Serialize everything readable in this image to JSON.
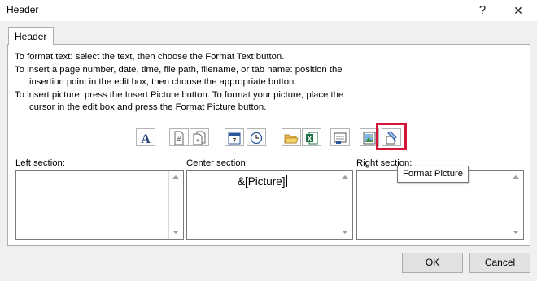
{
  "window": {
    "title": "Header",
    "help_label": "?",
    "close_label": "✕"
  },
  "tab": {
    "label": "Header"
  },
  "instructions": [
    "To format text:  select the text, then choose the Format Text button.",
    "To insert a page number, date, time, file path, filename, or tab name:  position the",
    "insertion point in the edit box, then choose the appropriate button.",
    "To insert picture: press the Insert Picture button.  To format your picture, place the",
    "cursor in the edit box and press the Format Picture button."
  ],
  "toolbar": [
    {
      "name": "format-text",
      "icon": "format-text-icon",
      "glyph": "A"
    },
    {
      "name": "insert-page-number",
      "icon": "page-number-icon"
    },
    {
      "name": "insert-number-of-pages",
      "icon": "number-of-pages-icon"
    },
    {
      "name": "insert-date",
      "icon": "calendar-icon",
      "glyph": "7"
    },
    {
      "name": "insert-time",
      "icon": "clock-icon"
    },
    {
      "name": "insert-file-path",
      "icon": "folder-icon"
    },
    {
      "name": "insert-file-name",
      "icon": "excel-icon",
      "glyph": "X"
    },
    {
      "name": "insert-sheet-name",
      "icon": "sheet-tab-icon"
    },
    {
      "name": "insert-picture",
      "icon": "picture-icon"
    },
    {
      "name": "format-picture",
      "icon": "format-picture-icon"
    }
  ],
  "highlight_color": "#d4163a",
  "sections": {
    "left": {
      "label": "Left section:",
      "content": ""
    },
    "center": {
      "label": "Center section:",
      "content": "&[Picture]"
    },
    "right": {
      "label": "Right section:",
      "content": ""
    }
  },
  "tooltip": {
    "text": "Format Picture"
  },
  "buttons": {
    "ok": "OK",
    "cancel": "Cancel"
  }
}
